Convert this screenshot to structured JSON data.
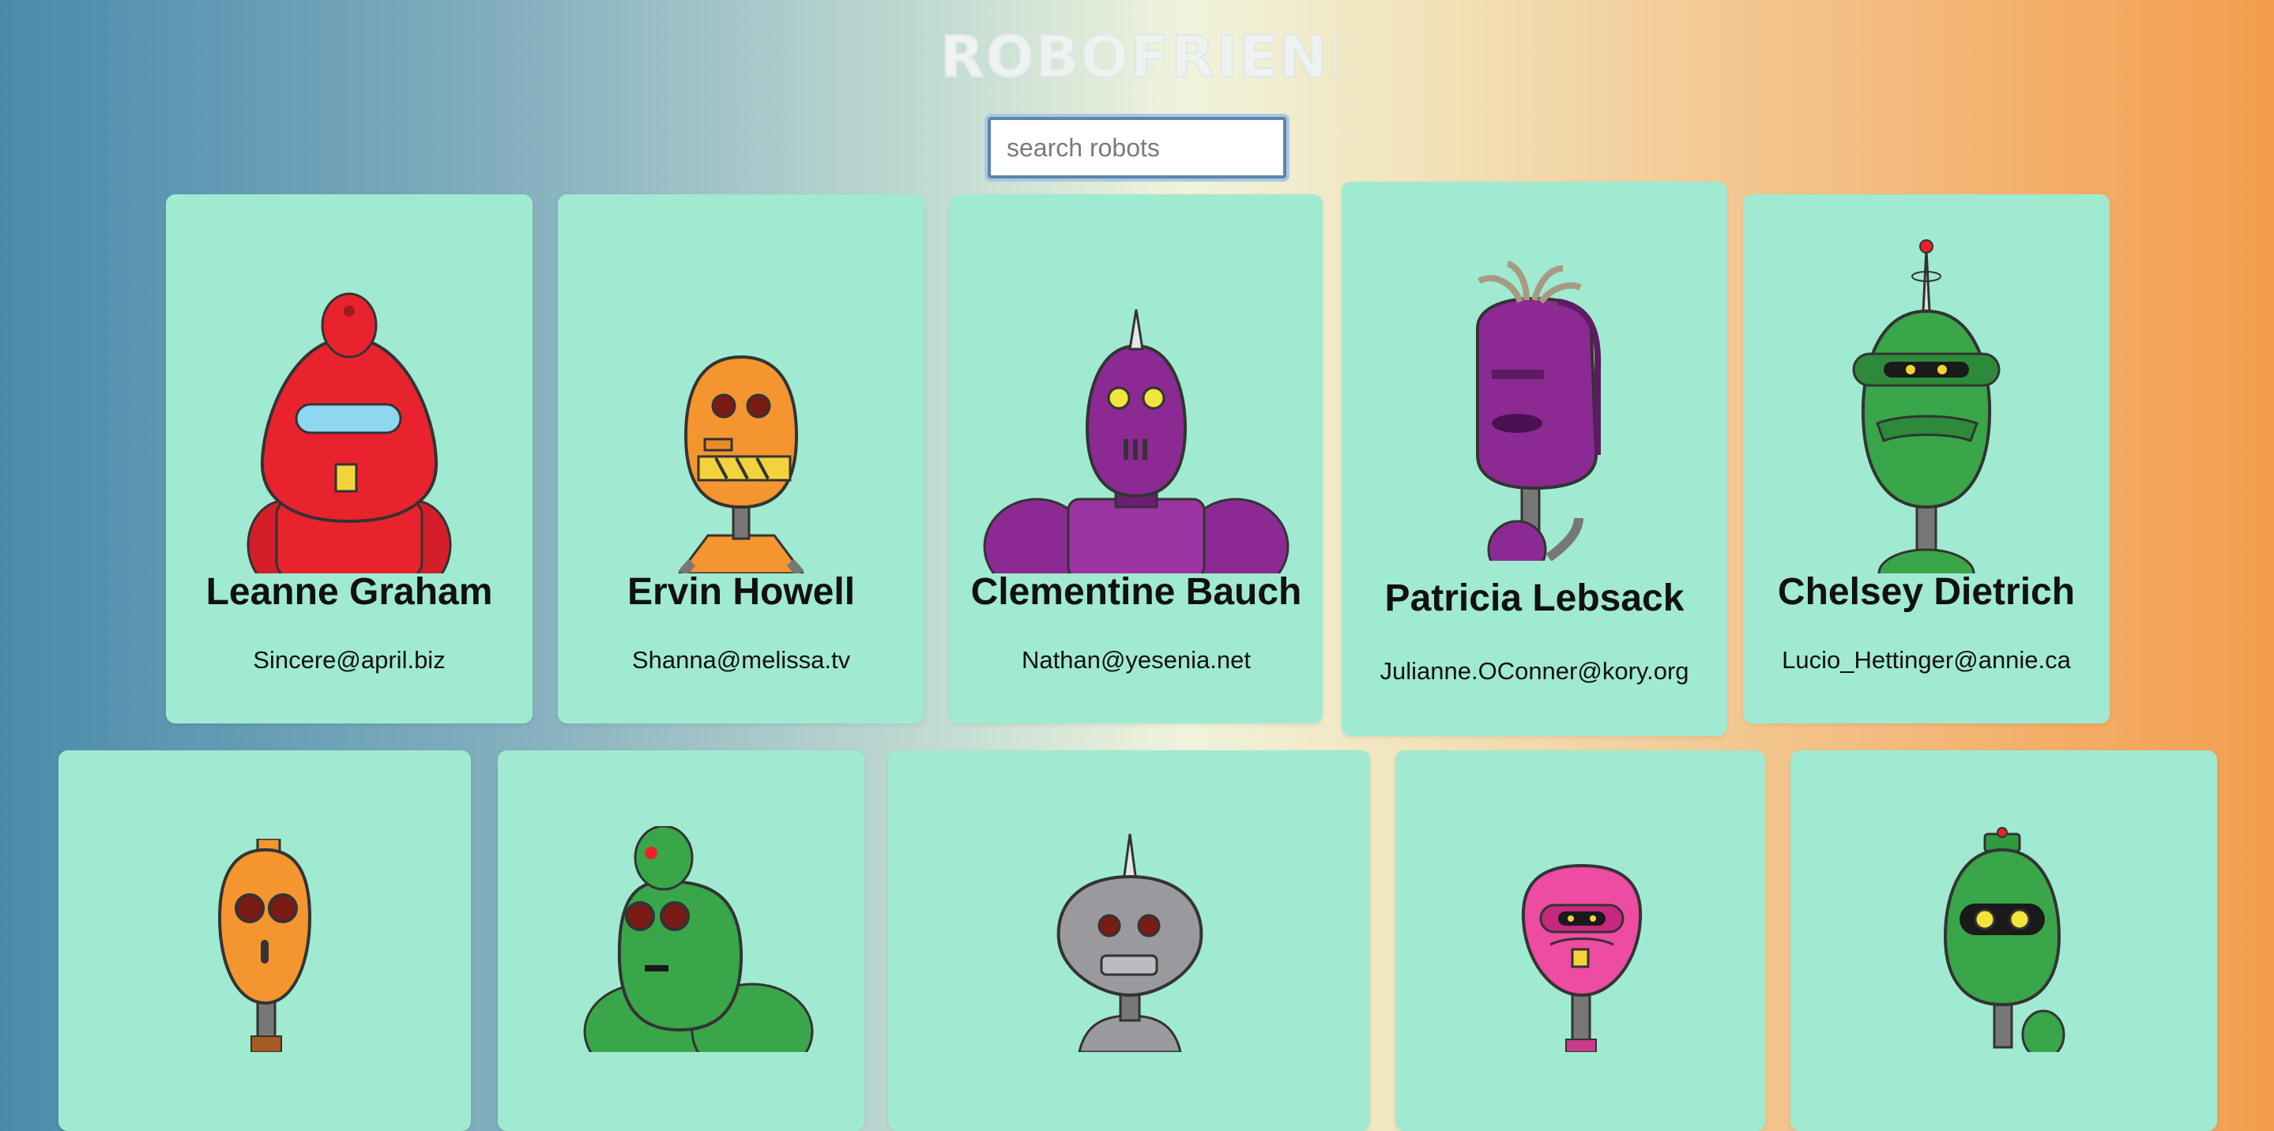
{
  "header": {
    "title": "ROBOFRIENDS"
  },
  "search": {
    "placeholder": "search robots",
    "value": ""
  },
  "robots": [
    {
      "name": "Leanne Graham",
      "email": "Sincere@april.biz",
      "color": "#e8232e"
    },
    {
      "name": "Ervin Howell",
      "email": "Shanna@melissa.tv",
      "color": "#f4952f"
    },
    {
      "name": "Clementine Bauch",
      "email": "Nathan@yesenia.net",
      "color": "#8b2a92"
    },
    {
      "name": "Patricia Lebsack",
      "email": "Julianne.OConner@kory.org",
      "color": "#8b2a92"
    },
    {
      "name": "Chelsey Dietrich",
      "email": "Lucio_Hettinger@annie.ca",
      "color": "#3aa64a"
    },
    {
      "color": "#f4952f"
    },
    {
      "color": "#3aa64a"
    },
    {
      "color": "#9a9a9e"
    },
    {
      "color": "#ee4ba2"
    },
    {
      "color": "#3aa64a"
    }
  ],
  "theme": {
    "card_bg": "#a0ead1",
    "focus_ring": "#a9c8e6"
  }
}
